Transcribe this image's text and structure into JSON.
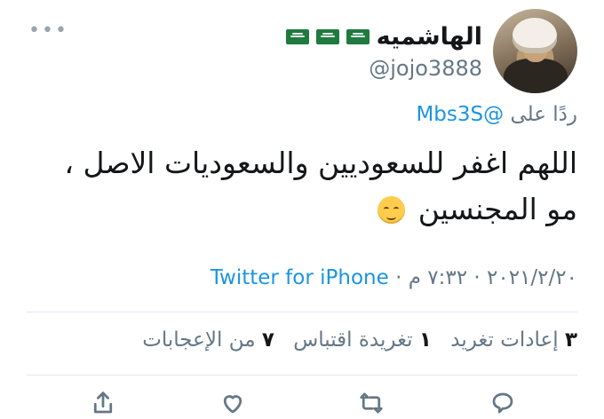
{
  "tweet": {
    "author": {
      "display_name": "الهاشميه",
      "handle": "@jojo3888",
      "flag_icons": [
        "saudi-flag-icon",
        "saudi-flag-icon",
        "saudi-flag-icon"
      ]
    },
    "reply": {
      "prefix": "ردًا على",
      "mention": "@Mbs3S"
    },
    "text_line1": "اللهم اغفر للسعوديين والسعوديات الاصل ،",
    "text_line2": "مو المجنسين",
    "emoji": "relieved-face-emoji",
    "meta": {
      "date": "٢٠٢١/٢/٢٠",
      "separator": "·",
      "time": "٧:٣٢ م",
      "source": "Twitter for iPhone"
    },
    "stats": {
      "retweets_count": "٣",
      "retweets_label": "إعادات تغريد",
      "quotes_count": "١",
      "quotes_label": "تغريدة اقتباس",
      "likes_count": "٧",
      "likes_label": "من الإعجابات"
    },
    "actions": [
      "comment-icon",
      "retweet-icon",
      "like-icon",
      "share-icon"
    ]
  },
  "colors": {
    "link": "#1b95e0",
    "secondary": "#657786",
    "text": "#14171a",
    "divider": "#e1e8ed"
  }
}
